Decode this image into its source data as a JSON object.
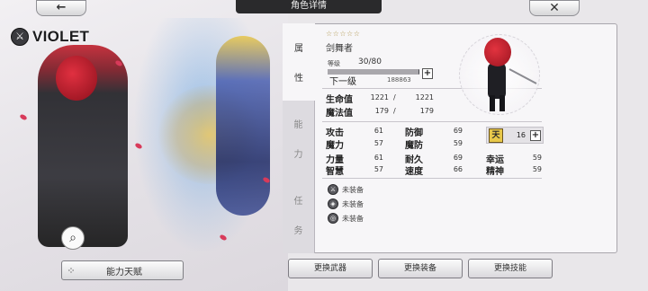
{
  "nav": {
    "back_label": "←",
    "close_label": "✕",
    "title": "角色详情"
  },
  "character": {
    "name": "VIOLET"
  },
  "talent_button": {
    "label": "能力天赋",
    "icon": "grid-icon"
  },
  "zoom_button": {
    "icon": "magnifier-icon"
  },
  "tabs": [
    {
      "label": [
        "属",
        "性"
      ],
      "active": true
    },
    {
      "label": [
        "能",
        "力"
      ],
      "active": false
    },
    {
      "label": [
        "任",
        "务"
      ],
      "active": false
    }
  ],
  "profile": {
    "stars": "☆☆☆☆☆",
    "job": "剑舞者",
    "level_label": "等级",
    "level_current": "30",
    "level_max": "80",
    "level_display": "30/80",
    "exp_fraction": 0.99,
    "next_label": "下一级",
    "next_value": "188863"
  },
  "vitals": [
    {
      "label": "生命值",
      "current": "1221",
      "max": "1221"
    },
    {
      "label": "魔法值",
      "current": "179",
      "max": "179"
    }
  ],
  "stats": {
    "col1": [
      {
        "label": "攻击",
        "value": "61"
      },
      {
        "label": "魔力",
        "value": "57"
      },
      {
        "label": "力量",
        "value": "61"
      },
      {
        "label": "智慧",
        "value": "57"
      }
    ],
    "col2": [
      {
        "label": "防御",
        "value": "69"
      },
      {
        "label": "魔防",
        "value": "59"
      },
      {
        "label": "耐久",
        "value": "69"
      },
      {
        "label": "速度",
        "value": "66"
      }
    ],
    "col3": [
      {
        "label": "幸运",
        "value": "59"
      },
      {
        "label": "精神",
        "value": "59"
      }
    ],
    "points_icon_text": "天",
    "points_value": "16"
  },
  "equipment": [
    {
      "label": "未装备",
      "icon": "sword-icon"
    },
    {
      "label": "未装备",
      "icon": "armor-icon"
    },
    {
      "label": "未装备",
      "icon": "skill-icon"
    }
  ],
  "buttons": {
    "change_weapon": "更换武器",
    "change_gear": "更换装备",
    "change_skill": "更换技能"
  },
  "colors": {
    "accent_gold": "#e8c84a",
    "hair_red": "#c01e2b"
  }
}
